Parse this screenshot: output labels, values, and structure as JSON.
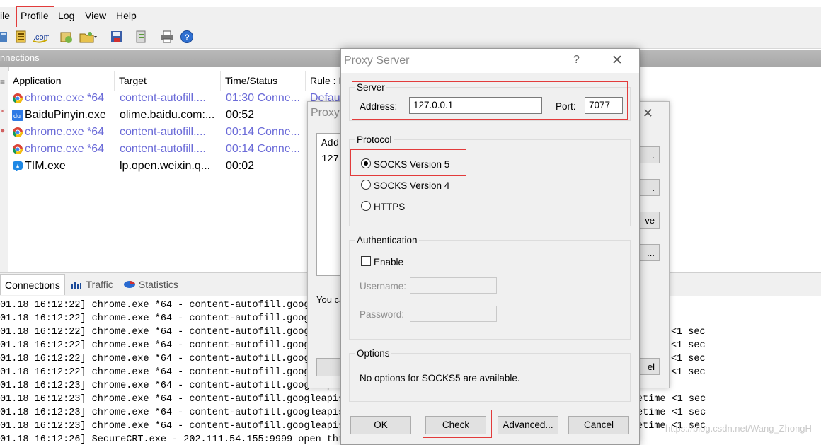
{
  "menu": {
    "file": "ile",
    "profile": "Profile",
    "log": "Log",
    "view": "View",
    "help": "Help"
  },
  "connections_title": "nnections",
  "grid": {
    "headers": [
      "Application",
      "Target",
      "Time/Status",
      "Rule : P"
    ],
    "rows": [
      {
        "app": "chrome.exe *64",
        "target": "content-autofill....",
        "time": "01:30 Conne...",
        "rule": "Defau",
        "style": "muted",
        "icon": "chrome-icon"
      },
      {
        "app": "BaiduPinyin.exe",
        "target": "olime.baidu.com:...",
        "time": "00:52",
        "rule": "",
        "style": "normal",
        "icon": "baidu-pinyin-icon"
      },
      {
        "app": "chrome.exe *64",
        "target": "content-autofill....",
        "time": "00:14 Conne...",
        "rule": "",
        "style": "muted",
        "icon": "chrome-icon"
      },
      {
        "app": "chrome.exe *64",
        "target": "content-autofill....",
        "time": "00:14 Conne...",
        "rule": "",
        "style": "muted",
        "icon": "chrome-icon"
      },
      {
        "app": "TIM.exe",
        "target": "lp.open.weixin.q...",
        "time": "00:02",
        "rule": "",
        "style": "normal",
        "icon": "tim-icon"
      }
    ]
  },
  "tabs": {
    "connections": "Connections",
    "traffic": "Traffic",
    "statistics": "Statistics"
  },
  "log": [
    {
      "left": "01.18 16:12:22] chrome.exe *64 - content-autofill.googl",
      "right": ""
    },
    {
      "left": "01.18 16:12:22] chrome.exe *64 - content-autofill.googl",
      "right": ""
    },
    {
      "left": "01.18 16:12:22] chrome.exe *64 - content-autofill.googl",
      "right": "<1 sec"
    },
    {
      "left": "01.18 16:12:22] chrome.exe *64 - content-autofill.googl",
      "right": "<1 sec"
    },
    {
      "left": "01.18 16:12:22] chrome.exe *64 - content-autofill.googl",
      "right": "<1 sec"
    },
    {
      "left": "01.18 16:12:22] chrome.exe *64 - content-autofill.googl",
      "right": "<1 sec"
    },
    {
      "left": "01.18 16:12:23] chrome.exe *64 - content-autofill.googleapis.",
      "right": ""
    },
    {
      "left": "01.18 16:12:23] chrome.exe *64 - content-autofill.googleapis.",
      "right": "etime <1 sec"
    },
    {
      "left": "01.18 16:12:23] chrome.exe *64 - content-autofill.googleapis.",
      "right": "etime <1 sec"
    },
    {
      "left": "01.18 16:12:23] chrome.exe *64 - content-autofill.googleapis.",
      "right": "etime <1 sec"
    },
    {
      "left": "01.18 16:12:26] SecureCRT.exe - 202.111.54.155:9999 open thro",
      "right": ""
    }
  ],
  "watermark": "https://blog.csdn.net/Wang_ZhongH",
  "middle_dialog": {
    "title": "Proxy",
    "list_header": "Addr",
    "list_value": "127",
    "side_buttons": [
      ".",
      ".",
      "ve",
      "..."
    ],
    "hint": "You ca",
    "bottom_right_button": "el"
  },
  "dialog": {
    "title": "Proxy Server",
    "help": "?",
    "server": {
      "group": "Server",
      "address_label": "Address:",
      "address": "127.0.0.1",
      "port_label": "Port:",
      "port": "7077"
    },
    "protocol": {
      "group": "Protocol",
      "options": [
        "SOCKS Version 5",
        "SOCKS Version 4",
        "HTTPS"
      ],
      "selected": "SOCKS Version 5"
    },
    "auth": {
      "group": "Authentication",
      "enable": "Enable",
      "username_label": "Username:",
      "password_label": "Password:",
      "username": "",
      "password": ""
    },
    "options": {
      "group": "Options",
      "text": "No options for SOCKS5 are available."
    },
    "buttons": {
      "ok": "OK",
      "check": "Check",
      "advanced": "Advanced...",
      "cancel": "Cancel"
    }
  },
  "colors": {
    "highlight": "#e23b3b",
    "muted_text": "#6b6bd8",
    "title_gray": "#8a8a8a"
  }
}
